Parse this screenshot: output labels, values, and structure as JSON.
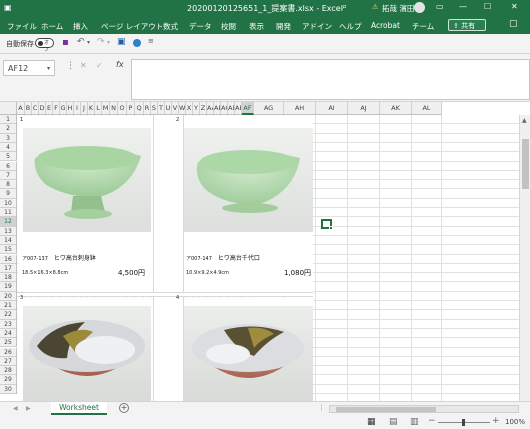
{
  "titlebar": {
    "title": "20200120125651_1_提案書.xlsx - Excel",
    "user_name": "拓哉 濱田",
    "warning": "⚠",
    "min": "—",
    "max": "☐",
    "close": "✕",
    "colors": {
      "accent": "#217346"
    }
  },
  "menubar": {
    "tabs": [
      "ファイル",
      "ホーム",
      "挿入",
      "ページ レイアウト",
      "数式",
      "データ",
      "校閲",
      "表示",
      "開発",
      "アドイン",
      "ヘルプ",
      "Acrobat",
      "チーム"
    ],
    "share_label": "共有",
    "comment_icon": "comment-icon"
  },
  "qat": {
    "autosave_label": "自動保存",
    "autosave_state": "オフ"
  },
  "formula_bar": {
    "name_box": "AF12",
    "fx_label": "fx",
    "formula_value": ""
  },
  "columns": [
    {
      "label": "A"
    },
    {
      "label": "B"
    },
    {
      "label": "C"
    },
    {
      "label": "D"
    },
    {
      "label": "E"
    },
    {
      "label": "F"
    },
    {
      "label": "G"
    },
    {
      "label": "H"
    },
    {
      "label": "I"
    },
    {
      "label": "J"
    },
    {
      "label": "K"
    },
    {
      "label": "L"
    },
    {
      "label": "M"
    },
    {
      "label": "N"
    },
    {
      "label": "O"
    },
    {
      "label": "P"
    },
    {
      "label": "Q"
    },
    {
      "label": "R"
    },
    {
      "label": "S"
    },
    {
      "label": "T"
    },
    {
      "label": "U"
    },
    {
      "label": "V"
    },
    {
      "label": "W"
    },
    {
      "label": "X"
    },
    {
      "label": "Y"
    },
    {
      "label": "Z"
    },
    {
      "label": "AA"
    },
    {
      "label": "AB"
    },
    {
      "label": "AC"
    },
    {
      "label": "AD"
    },
    {
      "label": "AE"
    },
    {
      "label": "AF"
    },
    {
      "label": "AG"
    },
    {
      "label": "AH"
    },
    {
      "label": "AI"
    },
    {
      "label": "AJ"
    },
    {
      "label": "AK"
    },
    {
      "label": "AL"
    }
  ],
  "rows": [
    "1",
    "2",
    "3",
    "4",
    "5",
    "6",
    "7",
    "8",
    "9",
    "10",
    "11",
    "12",
    "13",
    "14",
    "15",
    "16",
    "17",
    "18",
    "19",
    "20",
    "21",
    "22",
    "23",
    "24",
    "25",
    "26",
    "27",
    "28",
    "29",
    "30"
  ],
  "products": [
    {
      "index": "1",
      "code": "ア007-137",
      "name": "ヒワ高台刺身鉢",
      "size": "18.5×16.3×8.8cm",
      "price": "4,500円"
    },
    {
      "index": "2",
      "code": "ア007-147",
      "name": "ヒワ高台千代口",
      "size": "10.9×9.2×4.9cm",
      "price": "1,080円"
    },
    {
      "index": "3"
    },
    {
      "index": "4"
    }
  ],
  "sheet_tabs": {
    "active": "Worksheet",
    "add_label": "+"
  },
  "status": {
    "zoom": "100%"
  }
}
